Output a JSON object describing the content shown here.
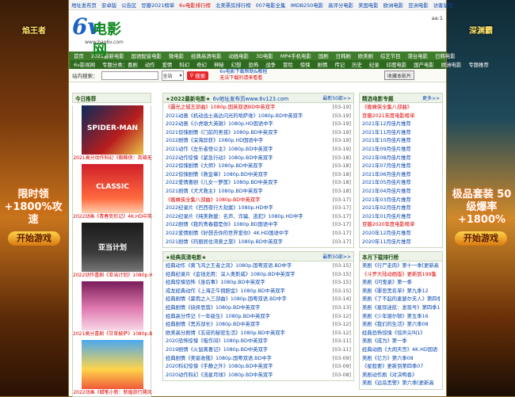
{
  "top_links": [
    "地址发布页",
    "安卓版",
    "公告区",
    "豆瓣2021榜单",
    "6v电影排行榜",
    "北美票房排行榜",
    "007电影全集",
    "IMDB250电影",
    "高评分电影",
    "美国电影",
    "欧洲电影",
    "亚洲电影",
    "访客留言"
  ],
  "header": {
    "logo_text": "6v电影网",
    "logo_url": "www.hao6v.com",
    "aa": "aa:1"
  },
  "nav_row1": [
    "首页",
    "2022最新电影",
    "国语配音电影",
    "微电影",
    "经典高清电影",
    "动画电影",
    "3D电影",
    "MP4手机电影",
    "国剧",
    "日韩剧",
    "欧美剧",
    "综艺节目",
    "港台电影",
    "日韩电影"
  ],
  "nav_row2": [
    "6v影视网",
    "专题分类：喜剧",
    "动作",
    "爱情",
    "科幻",
    "奇幻",
    "神秘",
    "幻想",
    "恐怖",
    "战争",
    "冒险",
    "惊悚",
    "剧情",
    "传记",
    "历史",
    "纪录",
    "印度电影",
    "国产电影",
    "欧洲电影",
    "专题推荐"
  ],
  "search": {
    "label": "站内搜索：",
    "placeholder": "",
    "select": "全站",
    "button": "搜索",
    "notice_a": "6v电影下载帮助&教程",
    "notice_b": "无法下载的请来看看",
    "fav": "收藏本影片"
  },
  "side": {
    "left_title": "焰王者",
    "right_title": "深渊霸",
    "left_promo": "限时领 +1800%攻速",
    "right_promo": "极品套装 50级爆率+1800%",
    "play": "开始游戏"
  },
  "today_rec": {
    "title": "今日推荐",
    "posters": [
      {
        "img_text": "SPIDER-MAN",
        "caption": "2021高分动作科幻《蜘蛛侠：英雄无"
      },
      {
        "img_text": "CLASSIC",
        "caption": "2022动画《青春变形记》4K.HD中英"
      },
      {
        "img_text": "亚当计划",
        "caption": "2022动作喜剧《亚当计划》1080p.H"
      },
      {
        "img_text": "",
        "caption": "2021高分喜剧《甘草披萨》1080p.B"
      },
      {
        "img_text": "",
        "caption": "2022动画《蜡笔小新：新婚旅行飓风"
      }
    ]
  },
  "latest": {
    "title": "★2022最新电影★",
    "sub": "6v地址发布页www.6v123.com",
    "more": "最新50部>>",
    "items": [
      {
        "t": "《霸光之城五部曲》1080p.国英双语BD中英双字",
        "d": "[03-19]",
        "red": true
      },
      {
        "t": "2021动画《机动战士高达闪光的哈萨维》1080p.BD中英双字",
        "d": "[03-19]",
        "red": false
      },
      {
        "t": "2022动画《小虎墩大英雄》1080p.HD国语中字",
        "d": "[03-19]",
        "red": false
      },
      {
        "t": "2021惊悚剧情《门前的男孩》1080p.BD中英双字",
        "d": "[03-19]",
        "red": false
      },
      {
        "t": "2022剧情《深海异获》1080p.HD国语中字",
        "d": "[03-19]",
        "red": false
      },
      {
        "t": "2021动作《左乐者怪公主》1080p.BD中英双字",
        "d": "[03-19]",
        "red": false
      },
      {
        "t": "2022动作惊悚《紧急行动》1080p.BD中英双字",
        "d": "[03-18]",
        "red": false
      },
      {
        "t": "2022惊悚剧情《大师》1080p.BD中英双字",
        "d": "[03-18]",
        "red": false
      },
      {
        "t": "2022惊悚剧情《救金章》1080p.BD中英双字",
        "d": "[03-18]",
        "red": false
      },
      {
        "t": "2022爱情喜剧《儿女一箩筐》1080p.BD中英双字",
        "d": "[03-18]",
        "red": false
      },
      {
        "t": "2021剧情《犬犬救主》1080p.BD中英双字",
        "d": "[03-18]",
        "red": false
      },
      {
        "t": "《蜘蛛侠全集八部曲》1080p.BD中英双字",
        "d": "[03-17]",
        "red": true
      },
      {
        "t": "2022纪录片《巴西夜行大劫案》1080p.HD中字",
        "d": "[03-17]",
        "red": false
      },
      {
        "t": "2022纪录片《纯美救援：名声、诈骗、逃犯》1080p.HD中字",
        "d": "[03-17]",
        "red": false
      },
      {
        "t": "2022剧情《我的青春都是你》1080p.BD国语中字",
        "d": "[03-17]",
        "red": false
      },
      {
        "t": "2022爱情剧情《好想去你的世界爱你》4K.HD国语中字",
        "d": "[03-17]",
        "red": false
      },
      {
        "t": "2021剧情《玛丽居住湾意之旅》1080p.BD中英双字",
        "d": "[03-17]",
        "red": false
      }
    ]
  },
  "classic": {
    "title": "★经典高清电影★",
    "more": "最新50部>>",
    "items": [
      {
        "t": "经典动作《黄飞鸿之王者之风》1080p.国粤双语.BD中字",
        "d": "[03-15]",
        "red": false
      },
      {
        "t": "经典纪录片《金钱无用：深入奥斯威》1080p.BD中英双字",
        "d": "[03-15]",
        "red": false
      },
      {
        "t": "经典惊悚恐怖《身后事》1080p.BD中英双字",
        "d": "[03-15]",
        "red": false
      },
      {
        "t": "成龙经典动作《上海正午佣胆金》1080p.BD中英双字",
        "d": "[03-15]",
        "red": false
      },
      {
        "t": "经典剧情《夏雨之入三部曲》1080p.国粤双语.BD中字",
        "d": "[03-14]",
        "red": false
      },
      {
        "t": "经典剧情《抉择思翡》1080p.BD中英双字",
        "d": "[03-13]",
        "red": false
      },
      {
        "t": "经典高分传记《一年级生》1080p.BD中英双字",
        "d": "[03-12]",
        "red": false
      },
      {
        "t": "经典剧情《黑苏部长》1080p.BD中英双字",
        "d": "[03-12]",
        "red": false
      },
      {
        "t": "欧美高分剧情《玄诺的秘密生活》1080p.BD中英双字",
        "d": "[03-12]",
        "red": false
      },
      {
        "t": "2020恐怖惊悚《吸作间》1080p.BD中英双字",
        "d": "[03-11]",
        "red": false
      },
      {
        "t": "2019剧情《火鼠离喜记》1080p.BD中英双字",
        "d": "[03-11]",
        "red": false
      },
      {
        "t": "经典剧情《美诞收俄》1080p.国粤双语.BD中字",
        "d": "[03-09]",
        "red": false
      },
      {
        "t": "2020科幻惊悚《手静之外》1080p.BD中英双字",
        "d": "[03-09]",
        "red": false
      },
      {
        "t": "2020动作科幻《流星月球》1080p.BD中英双字",
        "d": "[03-08]",
        "red": false
      }
    ]
  },
  "featured": {
    "title": "精选电影专题",
    "more": "更多>>",
    "items": [
      {
        "t": "《蜘蛛侠全集八部曲》",
        "red": true
      },
      {
        "t": "豆瓣2021年度电影榜单",
        "red": true
      },
      {
        "t": "2021年12月佳片推荐",
        "red": false
      },
      {
        "t": "2021年11月佳片推荐",
        "red": false
      },
      {
        "t": "2021年10月佳片推荐",
        "red": false
      },
      {
        "t": "2021年09月佳片推荐",
        "red": false
      },
      {
        "t": "2021年08月佳片推荐",
        "red": false
      },
      {
        "t": "2021年07月佳片推荐",
        "red": false
      },
      {
        "t": "2021年06月佳片推荐",
        "red": false
      },
      {
        "t": "2021年05月佳片推荐",
        "red": false
      },
      {
        "t": "2021年04月佳片推荐",
        "red": false
      },
      {
        "t": "2021年03月佳片推荐",
        "red": false
      },
      {
        "t": "2021年02月佳片推荐",
        "red": false
      },
      {
        "t": "2021年01月佳片推荐",
        "red": false
      },
      {
        "t": "豆瓣2020年度电影榜单",
        "red": true
      },
      {
        "t": "2020年12月佳片推荐",
        "red": false
      },
      {
        "t": "2020年11月佳片推荐",
        "red": false
      }
    ]
  },
  "monthly": {
    "title": "本月下载排行榜",
    "items": [
      {
        "t": "美剧《行尸走肉》第十一季[更新高",
        "red": false
      },
      {
        "t": "《斗罗大陆动画版》更新到199集",
        "red": true
      },
      {
        "t": "美剧《问鬼录》第一季",
        "red": false
      },
      {
        "t": "美剧《罪恶黑名单》第九季12",
        "red": false
      },
      {
        "t": "美剧《了不起的麦瑟尔夫人》第四季",
        "red": false
      },
      {
        "t": "美剧《星际迷航：发现号》第四季13",
        "red": false
      },
      {
        "t": "美剧《少年谢尔顿》第五季16",
        "red": false
      },
      {
        "t": "美剧《我们的生活》第六季08",
        "red": false
      },
      {
        "t": "经典恐怖惊悚《惊声尖叫1》",
        "red": false
      },
      {
        "t": "美剧《成为》第一季",
        "red": false
      },
      {
        "t": "经典动画《大闹天宫》4K.HD国语",
        "red": false
      },
      {
        "t": "美剧《亿万》第六季08",
        "red": false
      },
      {
        "t": "《星股要》更新到第四季07",
        "red": false
      },
      {
        "t": "美剧动作剧《对决鸭香》",
        "red": false
      },
      {
        "t": "美剧《远岳黑警》第六季[更新高",
        "red": false
      }
    ]
  },
  "colors": {
    "nav": "#3f7c2b",
    "link": "#0645ad",
    "hot": "#d00000",
    "search_btn": "#e6262b"
  }
}
